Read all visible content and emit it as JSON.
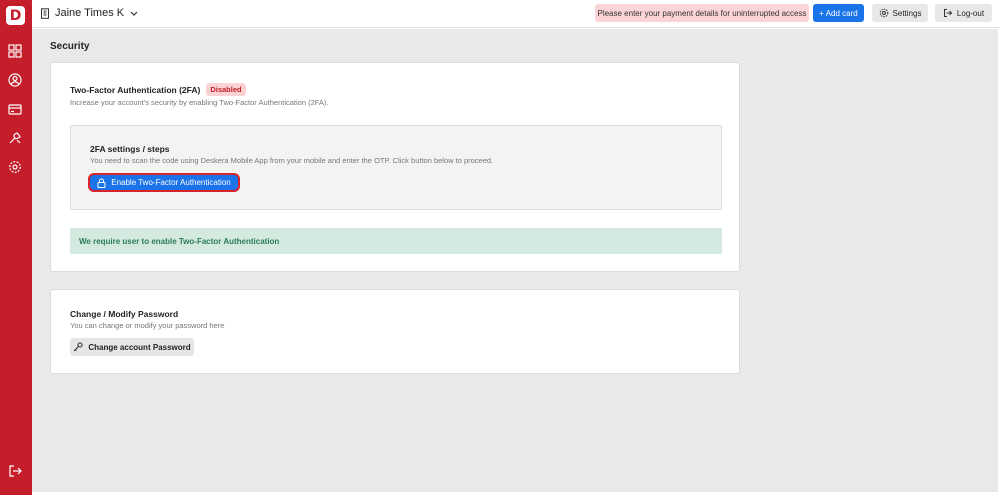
{
  "app": {
    "logo_letter": "D",
    "brand_color": "#c41e2b",
    "accent_color": "#1a73e8"
  },
  "sidebar": {
    "items": [
      {
        "icon": "dashboard-icon"
      },
      {
        "icon": "user-icon"
      },
      {
        "icon": "card-icon"
      },
      {
        "icon": "tools-icon"
      },
      {
        "icon": "gear-icon"
      }
    ],
    "logout_icon": "logout-icon"
  },
  "header": {
    "org_name": "Jaine Times K",
    "payment_notice": "Please enter your payment details for uninterrupted access",
    "add_card_label": "+ Add card",
    "settings_label": "Settings",
    "logout_label": "Log-out"
  },
  "main": {
    "page_title": "Security",
    "two_factor": {
      "title": "Two-Factor Authentication (2FA)",
      "status_badge": "Disabled",
      "description": "Increase your account's security by enabling Two-Factor Authentication (2FA).",
      "steps_title": "2FA settings / steps",
      "steps_description": "You need to scan the code using Deskera Mobile App from your mobile and enter the OTP. Click button below to proceed.",
      "enable_button_label": "Enable Two-Factor Authentication",
      "requirement_notice": "We require user to enable Two-Factor Authentication"
    },
    "password": {
      "title": "Change / Modify Password",
      "description": "You can change or modify your password here",
      "button_label": "Change account Password"
    }
  }
}
